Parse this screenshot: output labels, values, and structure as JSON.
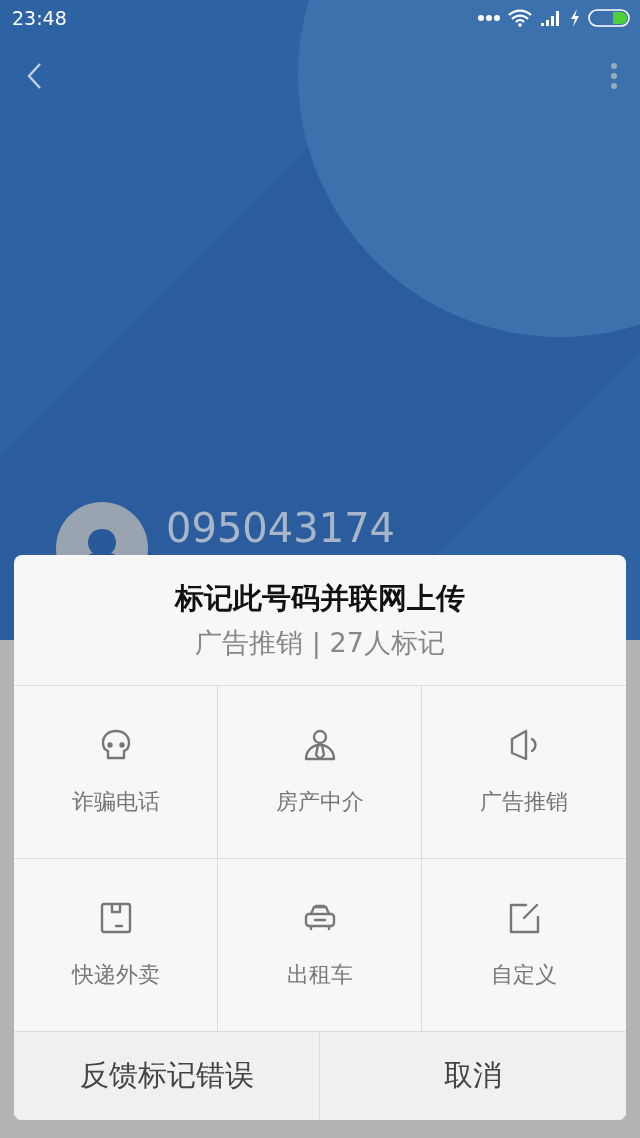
{
  "status_bar": {
    "time": "23:48"
  },
  "contact": {
    "number": "095043174"
  },
  "dialog": {
    "title": "标记此号码并联网上传",
    "subtitle": "广告推销 | 27人标记",
    "options": [
      {
        "kind": "fraud",
        "label": "诈骗电话"
      },
      {
        "kind": "agent",
        "label": "房产中介"
      },
      {
        "kind": "ad",
        "label": "广告推销"
      },
      {
        "kind": "delivery",
        "label": "快递外卖"
      },
      {
        "kind": "taxi",
        "label": "出租车"
      },
      {
        "kind": "custom",
        "label": "自定义"
      }
    ],
    "buttons": [
      "反馈标记错误",
      "取消"
    ]
  }
}
